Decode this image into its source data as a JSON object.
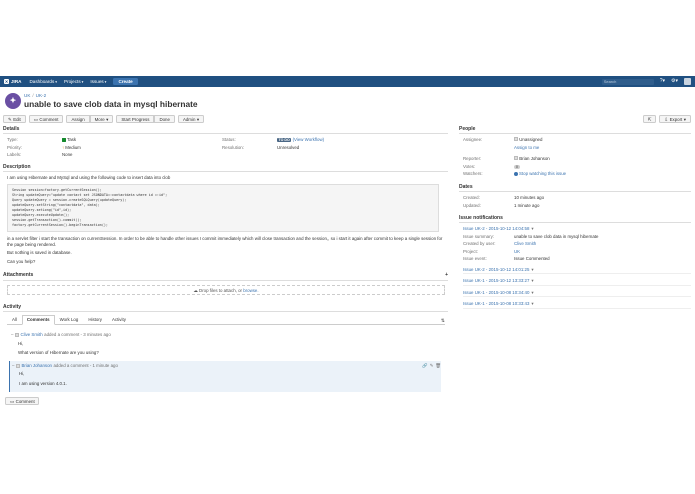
{
  "topnav": {
    "logo": "JIRA",
    "items": [
      "Dashboards",
      "Projects",
      "Issues"
    ],
    "create": "Create",
    "search_placeholder": "Search"
  },
  "issue": {
    "project": "UK",
    "key": "UK-2",
    "title": "unable to save clob data in mysql hibernate"
  },
  "toolbar": {
    "edit": "Edit",
    "comment": "Comment",
    "assign": "Assign",
    "more": "More",
    "start_progress": "Start Progress",
    "done": "Done",
    "admin": "Admin",
    "export": "Export"
  },
  "details": {
    "heading": "Details",
    "type_label": "Type:",
    "type_value": "Task",
    "priority_label": "Priority:",
    "priority_value": "Medium",
    "labels_label": "Labels:",
    "labels_value": "None",
    "status_label": "Status:",
    "status_value": "TO DO",
    "view_workflow": "(View Workflow)",
    "resolution_label": "Resolution:",
    "resolution_value": "Unresolved"
  },
  "description": {
    "heading": "Description",
    "intro": "I am using Hibernate and MySql and using the following code to insert data into clob",
    "code": [
      "Session session=factory.getCurrentSession();",
      "String updateQuery=\"update contact set JSONDATA=:contactdata where id =:id\";",
      "Query updateQuery = session.createSQLQuery(updateQuery);",
      "updateQuery.setString(\"contactdata\", data);",
      "updateQuery.setLong(\"id\",id);",
      "updateQuery.executeUpdate();",
      "session.getTransaction().commit();",
      "factory.getCurrentSession().beginTransaction();"
    ],
    "para1": "in a servlet filter i start the transaction on currentSession. In order to be able to handle other issues I commit immediately which will close transaction and the session,, so i start it again after commit to keep a single session for the page being rendered.",
    "para2": "But nothing is saved in database.",
    "para3": "Can you help?"
  },
  "attachments": {
    "heading": "Attachments",
    "drop_text": "Drop files to attach, or",
    "browse": "browse."
  },
  "activity": {
    "heading": "Activity",
    "tabs": [
      "All",
      "Comments",
      "Work Log",
      "History",
      "Activity"
    ],
    "comments": [
      {
        "author": "Clive Smith",
        "meta": "added a comment - 3 minutes ago",
        "lines": [
          "Hi,",
          "What version of Hibernate are you using?"
        ]
      },
      {
        "author": "Brian Johanson",
        "meta": "added a comment - 1 minute ago",
        "lines": [
          "Hi,",
          "I am using version 4.0.1."
        ]
      }
    ],
    "comment_button": "Comment"
  },
  "people": {
    "heading": "People",
    "assignee_label": "Assignee:",
    "assignee_value": "Unassigned",
    "assign_to_me": "Assign to me",
    "reporter_label": "Reporter:",
    "reporter_value": "Brian Johanson",
    "votes_label": "Votes:",
    "votes_value": "0",
    "watchers_label": "Watchers:",
    "watchers_value": "Stop watching this issue"
  },
  "dates": {
    "heading": "Dates",
    "created_label": "Created:",
    "created_value": "10 minutes ago",
    "updated_label": "Updated:",
    "updated_value": "1 minute ago"
  },
  "notifications": {
    "heading": "Issue notifications",
    "expanded": {
      "title": "Issue UK-2 - 2015-10-12 14:04:58",
      "summary_label": "Issue summary:",
      "summary_value": "unable to save clob data in mysql hibernate",
      "created_by_label": "Created by user:",
      "created_by_value": "Clive Smith",
      "project_label": "Project:",
      "project_value": "UK",
      "event_label": "Issue event:",
      "event_value": "Issue Commented"
    },
    "rows": [
      "Issue UK-2 - 2015-10-12 14:01:25",
      "Issue UK-1 - 2015-10-12 13:33:27",
      "Issue UK-1 - 2015-10-08 10:34:40",
      "Issue UK-1 - 2015-10-08 10:33:43"
    ]
  }
}
